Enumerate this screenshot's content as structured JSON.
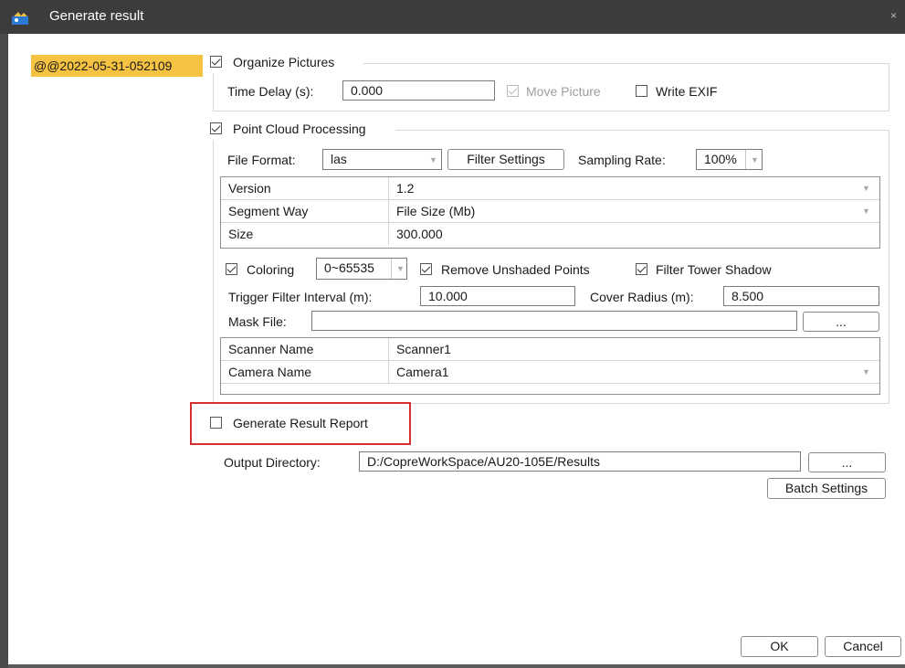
{
  "window": {
    "title": "Generate result",
    "close_glyph": "×",
    "app_icon": "app-icon"
  },
  "dataset_tag": "@@2022-05-31-052109",
  "organize_pictures": {
    "label": "Organize Pictures",
    "checked": true,
    "time_delay_label": "Time Delay (s):",
    "time_delay_value": "0.000",
    "move_picture_label": "Move Picture",
    "move_picture_checked": true,
    "move_picture_enabled": false,
    "write_exif_label": "Write EXIF",
    "write_exif_checked": false
  },
  "point_cloud": {
    "label": "Point Cloud Processing",
    "checked": true,
    "file_format_label": "File Format:",
    "file_format_value": "las",
    "filter_settings_label": "Filter Settings",
    "sampling_rate_label": "Sampling Rate:",
    "sampling_rate_value": "100%",
    "properties": [
      {
        "name": "Version",
        "value": "1.2",
        "dropdown": true
      },
      {
        "name": "Segment Way",
        "value": "File Size (Mb)",
        "dropdown": true
      },
      {
        "name": "Size",
        "value": "300.000",
        "dropdown": false
      }
    ],
    "coloring_label": "Coloring",
    "coloring_checked": true,
    "coloring_range": "0~65535",
    "remove_unshaded_label": "Remove Unshaded Points",
    "remove_unshaded_checked": true,
    "filter_tower_label": "Filter Tower Shadow",
    "filter_tower_checked": true,
    "trigger_interval_label": "Trigger Filter Interval (m):",
    "trigger_interval_value": "10.000",
    "cover_radius_label": "Cover Radius (m):",
    "cover_radius_value": "8.500",
    "mask_file_label": "Mask File:",
    "mask_file_value": "",
    "browse_label": "...",
    "devices": [
      {
        "name": "Scanner Name",
        "value": "Scanner1",
        "dropdown": false
      },
      {
        "name": "Camera Name",
        "value": "Camera1",
        "dropdown": true
      }
    ]
  },
  "report": {
    "label": "Generate Result Report",
    "checked": false,
    "highlight_color": "#d32f2f"
  },
  "output": {
    "label": "Output Directory:",
    "value": "D:/CopreWorkSpace/AU20-105E/Results",
    "browse_label": "...",
    "batch_settings_label": "Batch Settings"
  },
  "footer": {
    "ok_label": "OK",
    "cancel_label": "Cancel"
  },
  "colors": {
    "titlebar": "#3c3c3c",
    "tag_background": "#f5c242"
  }
}
